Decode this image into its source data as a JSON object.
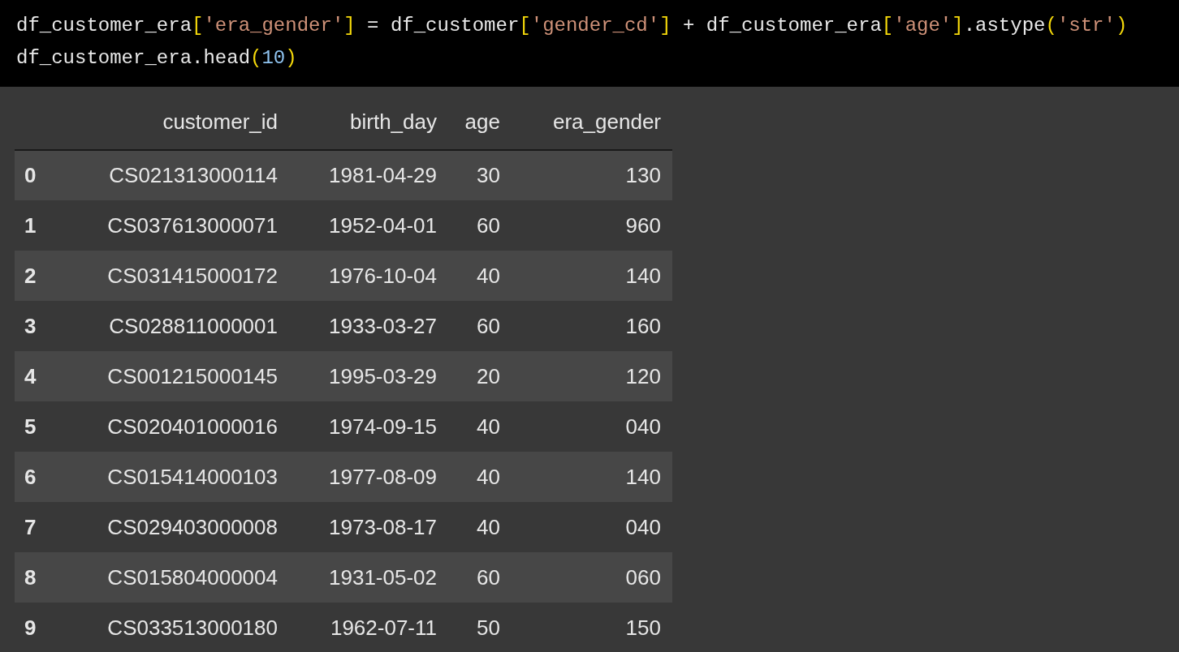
{
  "code": {
    "lines": [
      [
        {
          "kind": "plain",
          "text": "df_customer_era"
        },
        {
          "kind": "bracket",
          "text": "["
        },
        {
          "kind": "string",
          "text": "'era_gender'"
        },
        {
          "kind": "bracket",
          "text": "]"
        },
        {
          "kind": "plain",
          "text": " = df_customer"
        },
        {
          "kind": "bracket",
          "text": "["
        },
        {
          "kind": "string",
          "text": "'gender_cd'"
        },
        {
          "kind": "bracket",
          "text": "]"
        },
        {
          "kind": "plain",
          "text": " + df_customer_era"
        },
        {
          "kind": "bracket",
          "text": "["
        },
        {
          "kind": "string",
          "text": "'age'"
        },
        {
          "kind": "bracket",
          "text": "]"
        },
        {
          "kind": "plain",
          "text": ".astype"
        },
        {
          "kind": "bracket",
          "text": "("
        },
        {
          "kind": "string",
          "text": "'str'"
        },
        {
          "kind": "bracket",
          "text": ")"
        }
      ],
      [
        {
          "kind": "plain",
          "text": "df_customer_era.head"
        },
        {
          "kind": "bracket",
          "text": "("
        },
        {
          "kind": "number",
          "text": "10"
        },
        {
          "kind": "bracket",
          "text": ")"
        }
      ]
    ]
  },
  "table": {
    "columns": [
      "customer_id",
      "birth_day",
      "age",
      "era_gender"
    ],
    "rows": [
      {
        "index": "0",
        "cells": [
          "CS021313000114",
          "1981-04-29",
          "30",
          "130"
        ]
      },
      {
        "index": "1",
        "cells": [
          "CS037613000071",
          "1952-04-01",
          "60",
          "960"
        ]
      },
      {
        "index": "2",
        "cells": [
          "CS031415000172",
          "1976-10-04",
          "40",
          "140"
        ]
      },
      {
        "index": "3",
        "cells": [
          "CS028811000001",
          "1933-03-27",
          "60",
          "160"
        ]
      },
      {
        "index": "4",
        "cells": [
          "CS001215000145",
          "1995-03-29",
          "20",
          "120"
        ]
      },
      {
        "index": "5",
        "cells": [
          "CS020401000016",
          "1974-09-15",
          "40",
          "040"
        ]
      },
      {
        "index": "6",
        "cells": [
          "CS015414000103",
          "1977-08-09",
          "40",
          "140"
        ]
      },
      {
        "index": "7",
        "cells": [
          "CS029403000008",
          "1973-08-17",
          "40",
          "040"
        ]
      },
      {
        "index": "8",
        "cells": [
          "CS015804000004",
          "1931-05-02",
          "60",
          "060"
        ]
      },
      {
        "index": "9",
        "cells": [
          "CS033513000180",
          "1962-07-11",
          "50",
          "150"
        ]
      }
    ]
  }
}
